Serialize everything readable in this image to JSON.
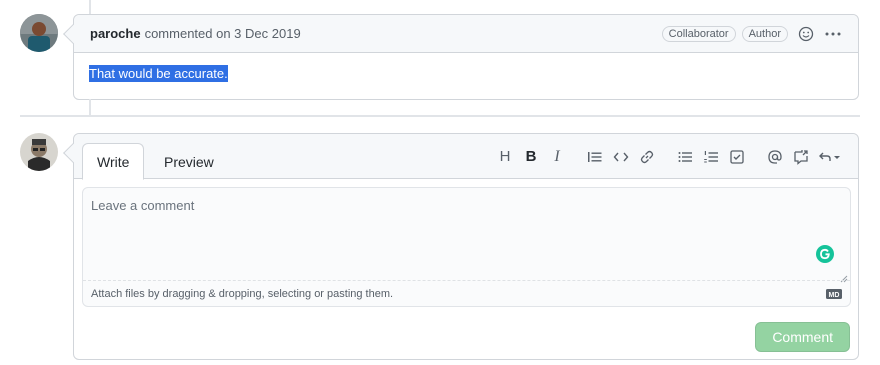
{
  "comment": {
    "author": "paroche",
    "meta": "commented on 3 Dec 2019",
    "badges": [
      "Collaborator",
      "Author"
    ],
    "body": "That would be accurate."
  },
  "editor": {
    "tabs": {
      "write": "Write",
      "preview": "Preview"
    },
    "toolbar": {
      "heading": "H",
      "bold": "B",
      "italic": "I"
    },
    "placeholder": "Leave a comment",
    "attach_hint": "Attach files by dragging & dropping, selecting or pasting them.",
    "markdown_badge": "MD",
    "submit_label": "Comment"
  },
  "colors": {
    "selection": "#2f6fe4",
    "submit_disabled": "#94d3a2",
    "grammarly": "#15c39a"
  },
  "icons": [
    "smiley-icon",
    "kebab-menu-icon",
    "quote-icon",
    "code-icon",
    "link-icon",
    "unordered-list-icon",
    "ordered-list-icon",
    "task-list-icon",
    "mention-icon",
    "cross-reference-icon",
    "reply-icon",
    "grammarly-icon",
    "markdown-icon",
    "resize-handle-icon"
  ]
}
